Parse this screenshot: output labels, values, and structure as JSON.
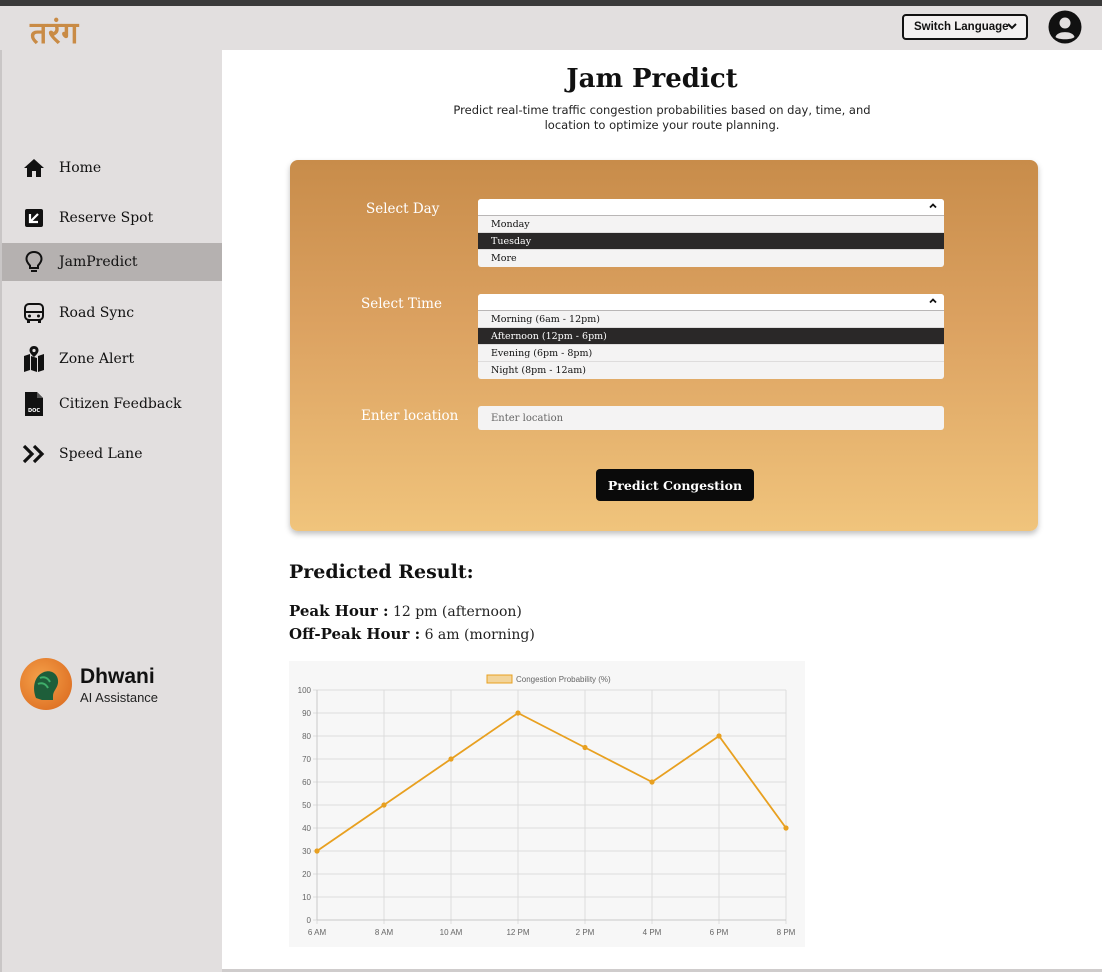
{
  "header": {
    "logo_text": "तरंग",
    "switch_language": "Switch Language"
  },
  "sidebar": {
    "items": [
      {
        "label": "Home",
        "icon": "home-icon"
      },
      {
        "label": "Reserve Spot",
        "icon": "reserve-icon"
      },
      {
        "label": "JamPredict",
        "icon": "lightbulb-icon",
        "active": true
      },
      {
        "label": "Road Sync",
        "icon": "bus-icon"
      },
      {
        "label": "Zone Alert",
        "icon": "map-pin-icon"
      },
      {
        "label": "Citizen Feedback",
        "icon": "doc-file-icon"
      },
      {
        "label": "Speed Lane",
        "icon": "double-chevron-right-icon"
      }
    ],
    "assistant": {
      "name": "Dhwani",
      "subtitle": "AI Assistance"
    }
  },
  "main": {
    "title": "Jam Predict",
    "subtitle": "Predict real-time traffic congestion probabilities based on day, time, and location to optimize your route planning.",
    "form": {
      "day_label": "Select Day",
      "day_options": [
        "Monday",
        "Tuesday",
        "More"
      ],
      "day_selected": "Tuesday",
      "time_label": "Select Time",
      "time_options": [
        "Morning (6am - 12pm)",
        "Afternoon (12pm - 6pm)",
        "Evening (6pm - 8pm)",
        "Night (8pm - 12am)"
      ],
      "time_selected": "Afternoon (12pm - 6pm)",
      "location_label": "Enter location",
      "location_placeholder": "Enter location",
      "location_value": "",
      "predict_button": "Predict Congestion"
    },
    "result": {
      "title": "Predicted Result:",
      "peak_label": "Peak Hour :",
      "peak_value": "12 pm (afternoon)",
      "offpeak_label": "Off-Peak Hour :",
      "offpeak_value": "6 am (morning)"
    }
  },
  "colors": {
    "accent": "#e8a020",
    "card_top": "#c88c4a",
    "card_bottom": "#f0c47c",
    "sidebar_bg": "#e2dfdf",
    "active_item": "#b5b1b0"
  },
  "chart_data": {
    "type": "line",
    "categories": [
      "6 AM",
      "8 AM",
      "10 AM",
      "12 PM",
      "2 PM",
      "4 PM",
      "6 PM",
      "8 PM"
    ],
    "series": [
      {
        "name": "Congestion Probability (%)",
        "values": [
          30,
          50,
          70,
          90,
          75,
          60,
          80,
          40
        ]
      }
    ],
    "title": "",
    "xlabel": "",
    "ylabel": "",
    "ylim": [
      0,
      100
    ],
    "yticks": [
      0,
      10,
      20,
      30,
      40,
      50,
      60,
      70,
      80,
      90,
      100
    ],
    "grid": true,
    "legend_position": "top",
    "line_color": "#e8a020",
    "legend_fill": "#f2d49a"
  }
}
